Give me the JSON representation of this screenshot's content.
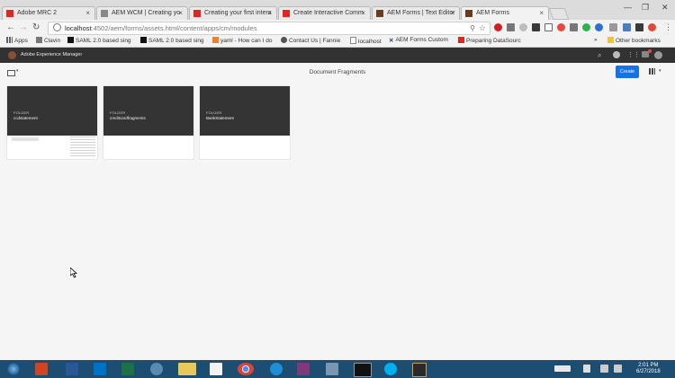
{
  "browser": {
    "tabs": [
      {
        "label": "Adobe MRC 2",
        "favicon": "adobe-icon",
        "color": "#e0261e"
      },
      {
        "label": "AEM WCM | Creating yo",
        "favicon": "page-icon",
        "color": "#888888"
      },
      {
        "label": "Creating your first intera",
        "favicon": "adobe-icon",
        "color": "#e0261e"
      },
      {
        "label": "Create Interactive Comm",
        "favicon": "adobe-icon",
        "color": "#e0261e"
      },
      {
        "label": "AEM Forms | Text Editor",
        "favicon": "aem-icon",
        "color": "#6b3a1f"
      },
      {
        "label": "AEM Forms",
        "favicon": "aem-icon",
        "color": "#6b3a1f"
      }
    ],
    "url_host": "localhost",
    "url_path": ":4502/aem/forms/assets.html/content/apps/cm/modules",
    "bookmarks": [
      {
        "label": "Apps",
        "icon": "apps-grid-icon"
      },
      {
        "label": "Clavin",
        "icon": "folder-icon"
      },
      {
        "label": "SAML 2.0 based sing",
        "icon": "medium-icon"
      },
      {
        "label": "SAML 2.0 based sing",
        "icon": "medium-icon"
      },
      {
        "label": "yaml - How can I do",
        "icon": "stackoverflow-icon"
      },
      {
        "label": "Contact Us | Fannie",
        "icon": "globe-icon"
      },
      {
        "label": "localhost",
        "icon": "page-icon"
      },
      {
        "label": "AEM Forms Custom",
        "icon": "x-icon"
      },
      {
        "label": "Preparing DataSourc",
        "icon": "adobe-icon"
      }
    ],
    "other_bookmarks": "Other bookmarks"
  },
  "aem": {
    "app_title": "Adobe Experience Manager",
    "page_title": "Document Fragments",
    "create_label": "Create",
    "folders": [
      {
        "type": "FOLDER",
        "name": "ccdstatement"
      },
      {
        "type": "FOLDER",
        "name": "creditcardfragments"
      },
      {
        "type": "FOLDER",
        "name": "BankStatement"
      }
    ]
  },
  "taskbar": {
    "time": "2:01 PM",
    "date": "6/27/2018"
  },
  "colors": {
    "aem_header": "#323232",
    "create_button": "#1473e6",
    "taskbar": "#1d4d70"
  }
}
